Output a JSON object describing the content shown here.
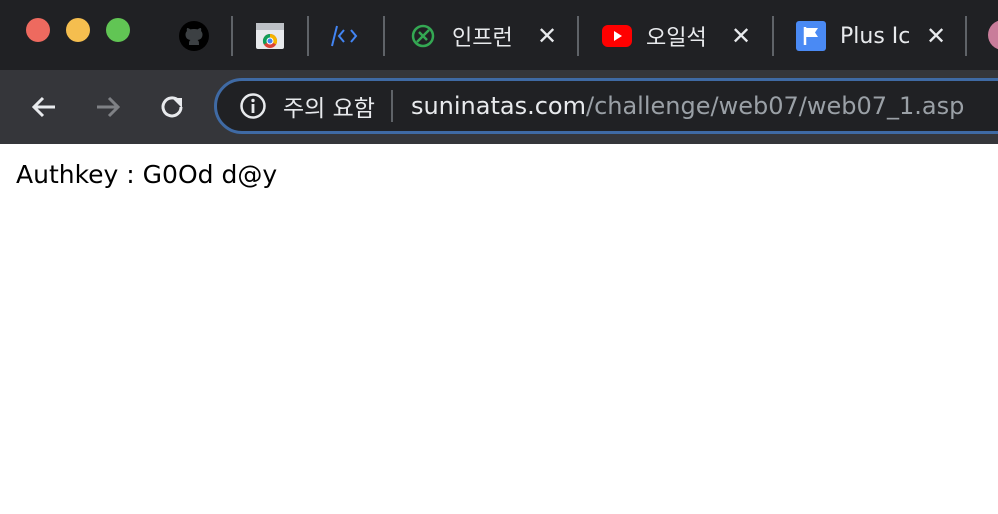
{
  "browser": {
    "tabs": [
      {
        "title": "인프런",
        "icon": "inflearn-icon"
      },
      {
        "title": "오일석",
        "icon": "youtube-icon"
      },
      {
        "title": "Plus Ic",
        "icon": "flag-icon"
      }
    ],
    "pinned_tabs": [
      "github-icon",
      "chrome-web-store-icon",
      "code-icon"
    ],
    "address_bar": {
      "security_label": "주의 요함",
      "url_host": "suninatas.com",
      "url_path": "/challenge/web07/web07_1.asp"
    }
  },
  "page": {
    "text": "Authkey : G0Od d@y"
  }
}
